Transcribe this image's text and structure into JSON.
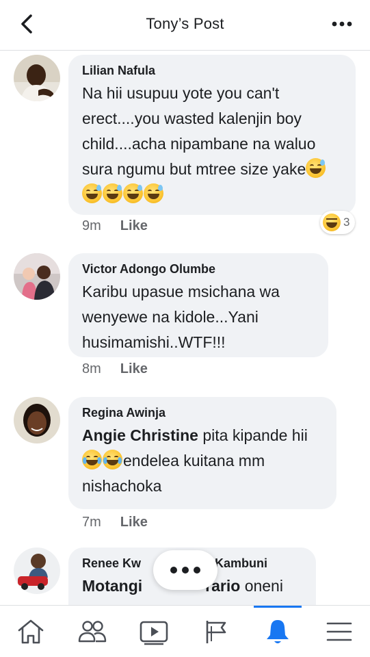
{
  "header": {
    "title": "Tony’s Post",
    "back_icon": "chevron-left-icon",
    "more_icon": "more-horizontal-icon"
  },
  "comments": [
    {
      "author": "Lilian Nafula",
      "text": "Na hii usupuu yote you can't erect....you wasted kalenjin boy child....acha nipambane na waluo sura ngumu but mtree size yake",
      "emojis": [
        "grinning-sweat-emoji",
        "grinning-sweat-emoji",
        "grinning-sweat-emoji",
        "grinning-sweat-emoji",
        "grinning-sweat-emoji"
      ],
      "time": "9m",
      "like_label": "Like",
      "reaction": {
        "icon": "laughing-emoji",
        "count": "3"
      }
    },
    {
      "author": "Victor Adongo Olumbe",
      "text": "Karibu upasue msichana wa wenyewe na kidole...Yani husimamishi..WTF!!!",
      "time": "8m",
      "like_label": "Like"
    },
    {
      "author": "Regina Awinja",
      "mention": "Angie Christine",
      "text_part1": "pita kipande hii",
      "emojis": [
        "tears-of-joy-emoji",
        "tears-of-joy-emoji"
      ],
      "text_part2": "endelea kuitana mm nishachoka",
      "time": "7m",
      "like_label": "Like"
    },
    {
      "author_left": "Renee Kw",
      "author_right": "Kambuni",
      "mention_left": "Motangi",
      "mention_right": "rario",
      "text": "oneni"
    }
  ],
  "bottom_nav": [
    {
      "name": "home",
      "icon": "home-icon"
    },
    {
      "name": "friends",
      "icon": "friends-icon"
    },
    {
      "name": "watch",
      "icon": "video-play-icon"
    },
    {
      "name": "pages",
      "icon": "flag-icon"
    },
    {
      "name": "notifications",
      "icon": "bell-icon",
      "active": true
    },
    {
      "name": "menu",
      "icon": "hamburger-menu-icon"
    }
  ],
  "colors": {
    "accent": "#1877f2",
    "bubble": "#f0f2f5",
    "meta_text": "#65676b",
    "text": "#1c1e21"
  }
}
